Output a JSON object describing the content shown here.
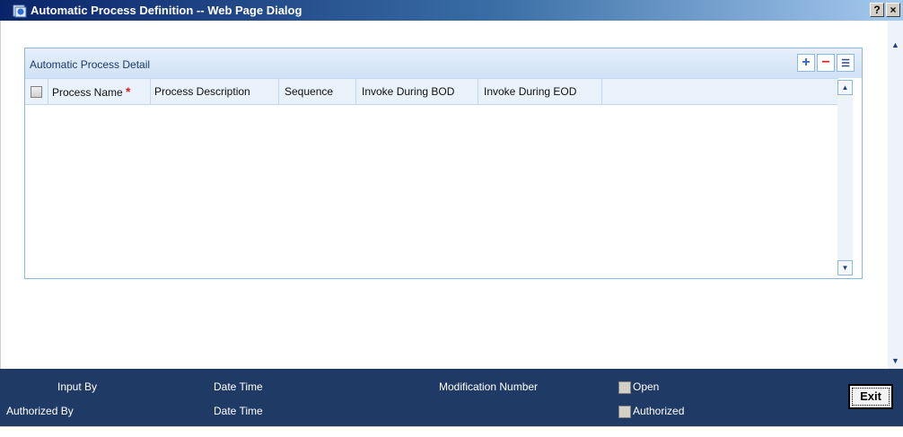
{
  "window": {
    "title": "Automatic Process Definition -- Web Page Dialog",
    "help_button": "?",
    "close_button": "×"
  },
  "panel": {
    "title": "Automatic Process Detail",
    "add_label": "+",
    "remove_label": "−",
    "list_label": "☰"
  },
  "grid": {
    "columns": [
      {
        "label": "Process Name",
        "required": "*"
      },
      {
        "label": "Process Description"
      },
      {
        "label": "Sequence"
      },
      {
        "label": "Invoke During BOD"
      },
      {
        "label": "Invoke During EOD"
      }
    ]
  },
  "footer": {
    "input_by": "Input By",
    "authorized_by": "Authorized By",
    "date_time_1": "Date Time",
    "date_time_2": "Date Time",
    "modification_number": "Modification Number",
    "open": "Open",
    "authorized": "Authorized",
    "exit": "Exit"
  },
  "icons": {
    "title": "ie-dialog-icon",
    "scroll_up": "scroll-up-arrow-icon",
    "scroll_down": "scroll-down-arrow-icon"
  }
}
